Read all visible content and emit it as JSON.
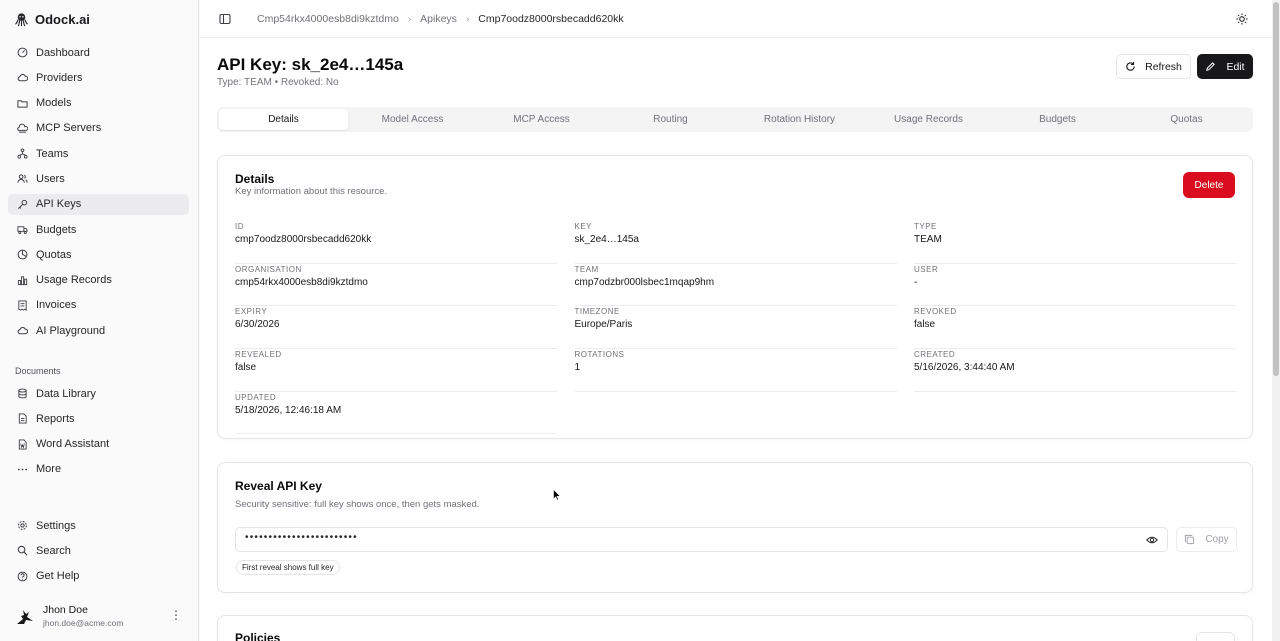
{
  "app": {
    "name": "Odock.ai",
    "logo_icon": "octopus-logo-icon"
  },
  "sidebar": {
    "items": [
      {
        "label": "Dashboard",
        "icon": "gauge-icon"
      },
      {
        "label": "Providers",
        "icon": "cloud-icon"
      },
      {
        "label": "Models",
        "icon": "folder-icon"
      },
      {
        "label": "MCP Servers",
        "icon": "server-icon"
      },
      {
        "label": "Teams",
        "icon": "network-icon"
      },
      {
        "label": "Users",
        "icon": "users-icon"
      },
      {
        "label": "API Keys",
        "icon": "key-icon",
        "active": true
      },
      {
        "label": "Budgets",
        "icon": "truck-icon"
      },
      {
        "label": "Quotas",
        "icon": "chart-pie-icon"
      },
      {
        "label": "Usage Records",
        "icon": "bar-chart-icon"
      },
      {
        "label": "Invoices",
        "icon": "receipt-icon"
      },
      {
        "label": "AI Playground",
        "icon": "cloud-icon"
      }
    ],
    "documents_label": "Documents",
    "documents": [
      {
        "label": "Data Library",
        "icon": "database-icon"
      },
      {
        "label": "Reports",
        "icon": "file-icon"
      },
      {
        "label": "Word Assistant",
        "icon": "file-word-icon"
      },
      {
        "label": "More",
        "icon": "more-horizontal-icon"
      }
    ],
    "footer_items": [
      {
        "label": "Settings",
        "icon": "gear-icon"
      },
      {
        "label": "Search",
        "icon": "search-icon"
      },
      {
        "label": "Get Help",
        "icon": "help-circle-icon"
      }
    ],
    "user": {
      "name": "Jhon Doe",
      "email": "jhon.doe@acme.com",
      "menu_glyph": "⋮"
    }
  },
  "breadcrumb": [
    "Cmp54rkx4000esb8di9kztdmo",
    "Apikeys",
    "Cmp7oodz8000rsbecadd620kk"
  ],
  "header": {
    "title": "API Key: sk_2e4…145a",
    "subtitle": "Type: TEAM • Revoked: No",
    "refresh_label": "Refresh",
    "edit_label": "Edit"
  },
  "tabs": [
    "Details",
    "Model Access",
    "MCP Access",
    "Routing",
    "Rotation History",
    "Usage Records",
    "Budgets",
    "Quotas"
  ],
  "details": {
    "title": "Details",
    "description": "Key information about this resource.",
    "delete_label": "Delete",
    "fields": [
      {
        "label": "ID",
        "value": "cmp7oodz8000rsbecadd620kk"
      },
      {
        "label": "KEY",
        "value": "sk_2e4…145a"
      },
      {
        "label": "TYPE",
        "value": "TEAM"
      },
      {
        "label": "ORGANISATION",
        "value": "cmp54rkx4000esb8di9kztdmo"
      },
      {
        "label": "TEAM",
        "value": "cmp7odzbr000lsbec1mqap9hm"
      },
      {
        "label": "USER",
        "value": "-"
      },
      {
        "label": "EXPIRY",
        "value": "6/30/2026"
      },
      {
        "label": "TIMEZONE",
        "value": "Europe/Paris"
      },
      {
        "label": "REVOKED",
        "value": "false"
      },
      {
        "label": "REVEALED",
        "value": "false"
      },
      {
        "label": "ROTATIONS",
        "value": "1"
      },
      {
        "label": "CREATED",
        "value": "5/16/2026, 3:44:40 AM"
      },
      {
        "label": "UPDATED",
        "value": "5/18/2026, 12:46:18 AM"
      }
    ]
  },
  "reveal": {
    "title": "Reveal API Key",
    "description": "Security sensitive: full key shows once, then gets masked.",
    "masked_value": "••••••••••••••••••••••••",
    "copy_label": "Copy",
    "hint": "First reveal shows full key"
  },
  "policies": {
    "title": "Policies"
  }
}
